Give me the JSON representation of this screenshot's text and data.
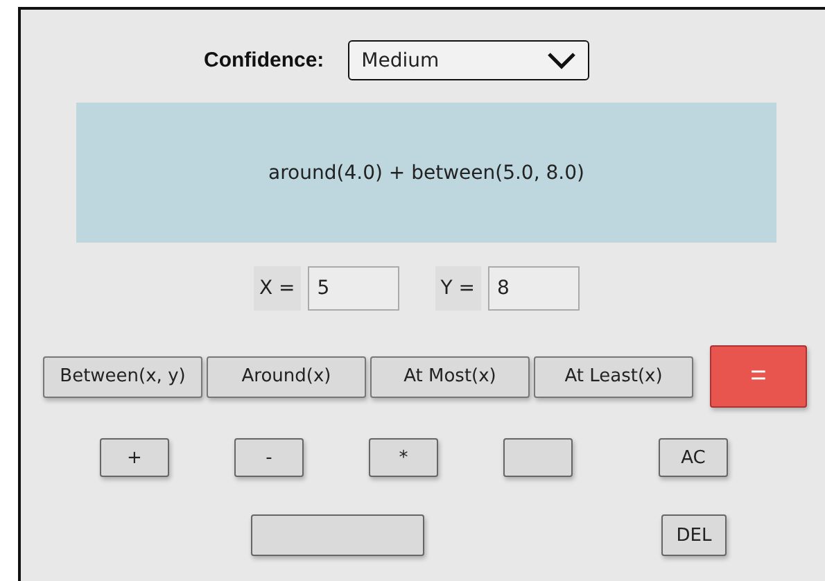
{
  "confidence": {
    "label": "Confidence:",
    "value": "Medium"
  },
  "expression": "around(4.0) + between(5.0, 8.0)",
  "inputs": [
    {
      "label": "X =",
      "value": "5"
    },
    {
      "label": "Y =",
      "value": "8"
    }
  ],
  "function_buttons": [
    "Between(x, y)",
    "Around(x)",
    "At Most(x)",
    "At Least(x)"
  ],
  "equals_button": "=",
  "operator_row": [
    {
      "kind": "key",
      "label": "+"
    },
    {
      "kind": "key",
      "label": "-"
    },
    {
      "kind": "key",
      "label": "*"
    },
    {
      "kind": "blank"
    },
    {
      "kind": "key",
      "label": "AC"
    }
  ],
  "bottom_row": [
    {
      "kind": "blank"
    },
    {
      "kind": "key",
      "label": "DEL"
    }
  ]
}
